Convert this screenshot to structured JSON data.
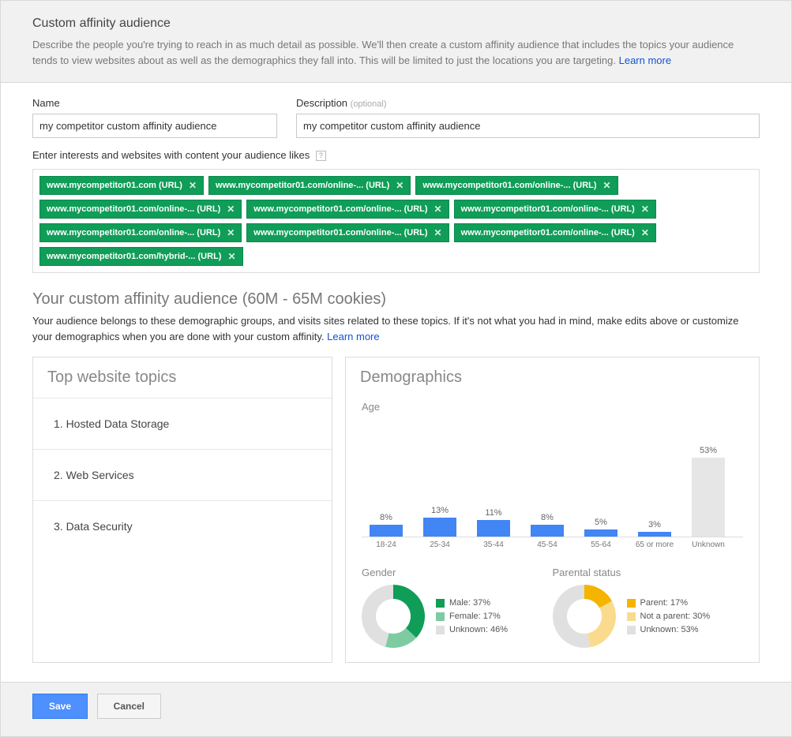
{
  "header": {
    "title": "Custom affinity audience",
    "description": "Describe the people you're trying to reach in as much detail as possible. We'll then create a custom affinity audience that includes the topics your audience tends to view websites about as well as the demographics they fall into. This will be limited to just the locations you are targeting.",
    "learn_more": "Learn more"
  },
  "form": {
    "name_label": "Name",
    "name_value": "my competitor custom affinity audience",
    "desc_label": "Description",
    "desc_optional": "(optional)",
    "desc_value": "my competitor custom affinity audience",
    "interests_label": "Enter interests and websites with content your audience likes",
    "chips": [
      "www.mycompetitor01.com (URL)",
      "www.mycompetitor01.com/online-... (URL)",
      "www.mycompetitor01.com/online-... (URL)",
      "www.mycompetitor01.com/online-... (URL)",
      "www.mycompetitor01.com/online-... (URL)",
      "www.mycompetitor01.com/online-... (URL)",
      "www.mycompetitor01.com/online-... (URL)",
      "www.mycompetitor01.com/online-... (URL)",
      "www.mycompetitor01.com/online-... (URL)",
      "www.mycompetitor01.com/hybrid-... (URL)"
    ]
  },
  "audience": {
    "heading": "Your custom affinity audience (60M - 65M cookies)",
    "sub": "Your audience belongs to these demographic groups, and visits sites related to these topics. If it's not what you had in mind, make edits above or customize your demographics when you are done with your custom affinity.",
    "learn_more": "Learn more"
  },
  "topics": {
    "title": "Top website topics",
    "items": [
      "1. Hosted Data Storage",
      "2. Web Services",
      "3. Data Security"
    ]
  },
  "demographics": {
    "title": "Demographics",
    "age_label": "Age",
    "gender_label": "Gender",
    "parental_label": "Parental status",
    "gender_legend": [
      {
        "label": "Male: 37%",
        "color": "#0f9d58"
      },
      {
        "label": "Female: 17%",
        "color": "#7ecba1"
      },
      {
        "label": "Unknown: 46%",
        "color": "#e0e0e0"
      }
    ],
    "parental_legend": [
      {
        "label": "Parent: 17%",
        "color": "#f4b400"
      },
      {
        "label": "Not a parent: 30%",
        "color": "#fadb8e"
      },
      {
        "label": "Unknown: 53%",
        "color": "#e0e0e0"
      }
    ]
  },
  "chart_data": [
    {
      "type": "bar",
      "title": "Age",
      "categories": [
        "18-24",
        "25-34",
        "35-44",
        "45-54",
        "55-64",
        "65 or more",
        "Unknown"
      ],
      "values": [
        8,
        13,
        11,
        8,
        5,
        3,
        53
      ],
      "ylim": [
        0,
        100
      ],
      "ylabel": "%"
    },
    {
      "type": "pie",
      "title": "Gender",
      "series": [
        {
          "name": "Male",
          "value": 37,
          "color": "#0f9d58"
        },
        {
          "name": "Female",
          "value": 17,
          "color": "#7ecba1"
        },
        {
          "name": "Unknown",
          "value": 46,
          "color": "#e0e0e0"
        }
      ]
    },
    {
      "type": "pie",
      "title": "Parental status",
      "series": [
        {
          "name": "Parent",
          "value": 17,
          "color": "#f4b400"
        },
        {
          "name": "Not a parent",
          "value": 30,
          "color": "#fadb8e"
        },
        {
          "name": "Unknown",
          "value": 53,
          "color": "#e0e0e0"
        }
      ]
    }
  ],
  "footer": {
    "save": "Save",
    "cancel": "Cancel"
  }
}
